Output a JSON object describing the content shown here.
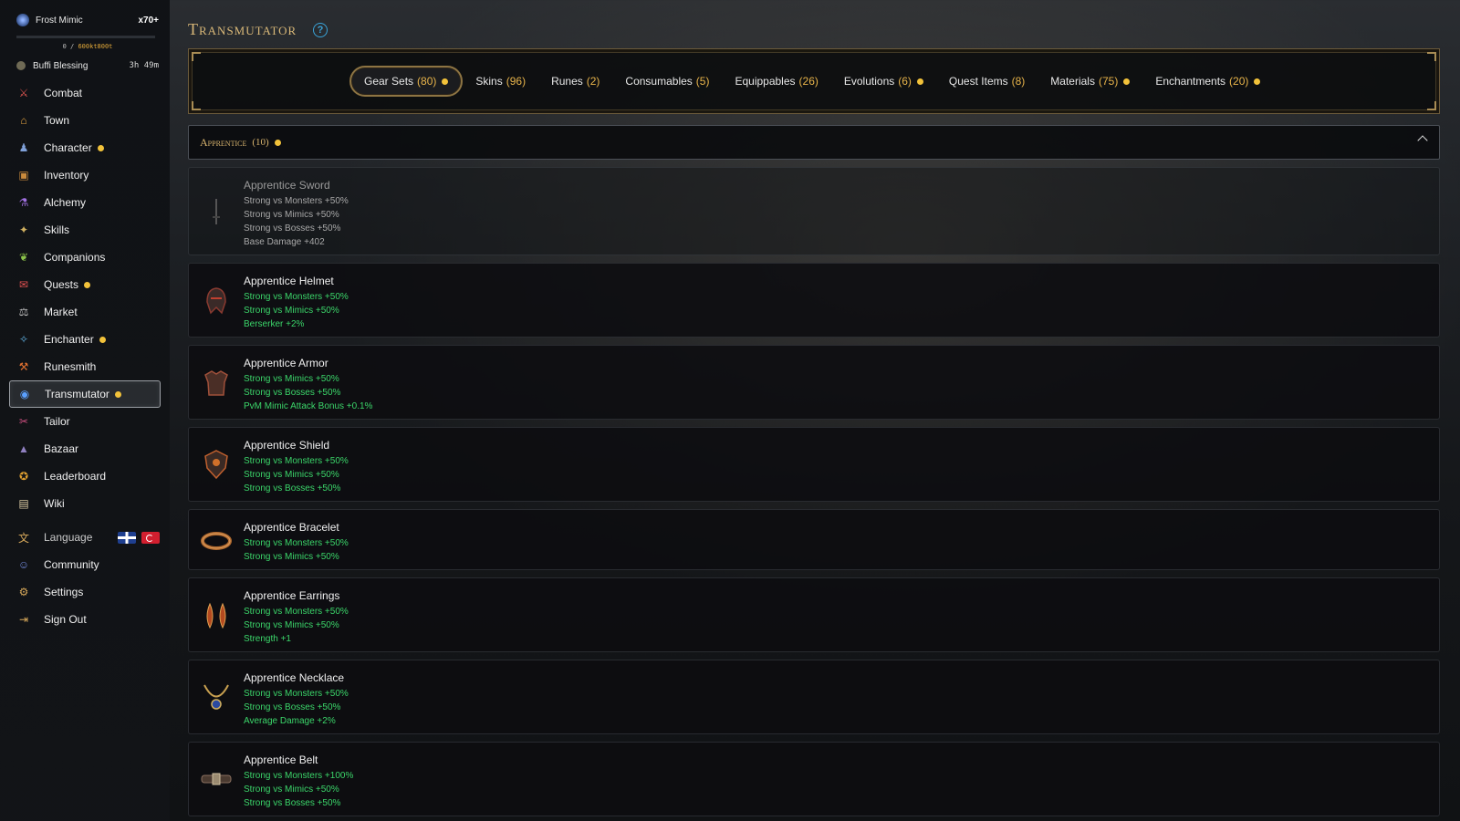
{
  "sidebar": {
    "boss": {
      "name": "Frost Mimic",
      "multiplier": "x70+",
      "hp_current": "0",
      "hp_sep": " / ",
      "hp_max": "600kt800t"
    },
    "buff": {
      "name": "Buffi Blessing",
      "time": "3h 49m"
    },
    "nav": [
      {
        "label": "Combat",
        "icon": "crossed-swords-icon",
        "dot": false
      },
      {
        "label": "Town",
        "icon": "town-icon",
        "dot": false
      },
      {
        "label": "Character",
        "icon": "character-icon",
        "dot": true
      },
      {
        "label": "Inventory",
        "icon": "chest-icon",
        "dot": false
      },
      {
        "label": "Alchemy",
        "icon": "potion-icon",
        "dot": false
      },
      {
        "label": "Skills",
        "icon": "skills-icon",
        "dot": false
      },
      {
        "label": "Companions",
        "icon": "paw-icon",
        "dot": false
      },
      {
        "label": "Quests",
        "icon": "scroll-icon",
        "dot": true
      },
      {
        "label": "Market",
        "icon": "scales-icon",
        "dot": false
      },
      {
        "label": "Enchanter",
        "icon": "wand-icon",
        "dot": true
      },
      {
        "label": "Runesmith",
        "icon": "hammer-icon",
        "dot": false
      },
      {
        "label": "Transmutator",
        "icon": "transmute-orb-icon",
        "dot": true
      },
      {
        "label": "Tailor",
        "icon": "needle-icon",
        "dot": false
      },
      {
        "label": "Bazaar",
        "icon": "tent-icon",
        "dot": false
      },
      {
        "label": "Leaderboard",
        "icon": "trophy-icon",
        "dot": false
      },
      {
        "label": "Wiki",
        "icon": "book-icon",
        "dot": false
      }
    ],
    "active": "Transmutator",
    "language_label": "Language",
    "bottom": [
      {
        "label": "Community",
        "icon": "discord-icon"
      },
      {
        "label": "Settings",
        "icon": "gear-icon"
      },
      {
        "label": "Sign Out",
        "icon": "sign-out-icon"
      }
    ]
  },
  "page": {
    "title": "Transmutator",
    "help": "?"
  },
  "tabs": [
    {
      "label": "Gear Sets",
      "count": "(80)",
      "dot": true,
      "active": true
    },
    {
      "label": "Skins",
      "count": "(96)",
      "dot": false
    },
    {
      "label": "Runes",
      "count": "(2)",
      "dot": false
    },
    {
      "label": "Consumables",
      "count": "(5)",
      "dot": false
    },
    {
      "label": "Equippables",
      "count": "(26)",
      "dot": false
    },
    {
      "label": "Evolutions",
      "count": "(6)",
      "dot": true
    },
    {
      "label": "Quest Items",
      "count": "(8)",
      "dot": false
    },
    {
      "label": "Materials",
      "count": "(75)",
      "dot": true
    },
    {
      "label": "Enchantments",
      "count": "(20)",
      "dot": true
    }
  ],
  "section": {
    "title": "Apprentice",
    "count": "(10)"
  },
  "items": [
    {
      "name": "Apprentice Sword",
      "faded": true,
      "icon": "sword-icon",
      "stats": [
        "Strong vs Monsters +50%",
        "Strong vs Mimics +50%",
        "Strong vs Bosses +50%",
        "Base Damage +402"
      ]
    },
    {
      "name": "Apprentice Helmet",
      "icon": "helmet-icon",
      "stats": [
        "Strong vs Monsters +50%",
        "Strong vs Mimics +50%",
        "Berserker +2%"
      ]
    },
    {
      "name": "Apprentice Armor",
      "icon": "armor-icon",
      "stats": [
        "Strong vs Mimics +50%",
        "Strong vs Bosses +50%",
        "PvM Mimic Attack Bonus +0.1%"
      ]
    },
    {
      "name": "Apprentice Shield",
      "icon": "shield-icon",
      "stats": [
        "Strong vs Monsters +50%",
        "Strong vs Mimics +50%",
        "Strong vs Bosses +50%"
      ]
    },
    {
      "name": "Apprentice Bracelet",
      "icon": "bracelet-icon",
      "stats": [
        "Strong vs Monsters +50%",
        "Strong vs Mimics +50%"
      ]
    },
    {
      "name": "Apprentice Earrings",
      "icon": "earrings-icon",
      "stats": [
        "Strong vs Monsters +50%",
        "Strong vs Mimics +50%",
        "Strength +1"
      ]
    },
    {
      "name": "Apprentice Necklace",
      "icon": "necklace-icon",
      "stats": [
        "Strong vs Monsters +50%",
        "Strong vs Bosses +50%",
        "Average Damage +2%"
      ]
    },
    {
      "name": "Apprentice Belt",
      "icon": "belt-icon",
      "stats": [
        "Strong vs Monsters +100%",
        "Strong vs Mimics +50%",
        "Strong vs Bosses +50%"
      ]
    }
  ],
  "colors": {
    "accent_gold": "#d9b878",
    "count_gold": "#e8b44a",
    "stat_green": "#3bd66a",
    "dot_yellow": "#f2c23a"
  }
}
